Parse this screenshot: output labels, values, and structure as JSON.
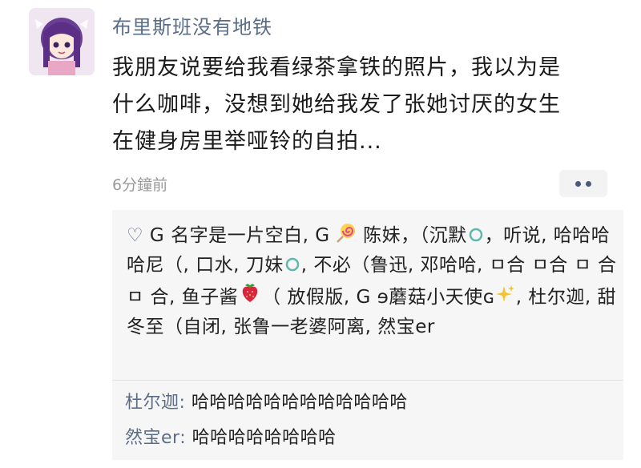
{
  "post": {
    "username": "布里斯班没有地铁",
    "text": "我朋友说要给我看绿茶拿铁的照片，我以为是什么咖啡，没想到她给我发了张她讨厌的女生在健身房里举哑铃的自拍...",
    "timestamp": "6分鐘前"
  },
  "likes": {
    "segments": [
      " G 名字是一片空白, G ",
      " 陈妹，（沉默",
      "，听说, 哈哈哈哈尼（, 口水, 刀妹",
      ", 不必（鲁迅, 邓哈哈, ㅁ合 ㅁ合 ㅁ 合 ㅁ 合, 鱼子酱",
      "（ 放假版, G ɘ蘑菇小天使ɢ",
      ", 杜尔迦, 甜冬至（自闭, 张鲁一老婆阿离, 然宝er"
    ]
  },
  "comments": [
    {
      "author": "杜尔迦: ",
      "text": "哈哈哈哈哈哈哈哈哈哈哈哈"
    },
    {
      "author": "然宝er: ",
      "text": "哈哈哈哈哈哈哈哈"
    }
  ],
  "colors": {
    "username": "#5a6d86",
    "timestamp": "#9a9a9a",
    "box_bg": "#f6f6f6"
  },
  "icons": [
    "heart-icon",
    "lollipop-icon",
    "teal-circle-icon",
    "strawberry-icon",
    "sparkles-icon",
    "more-icon"
  ]
}
